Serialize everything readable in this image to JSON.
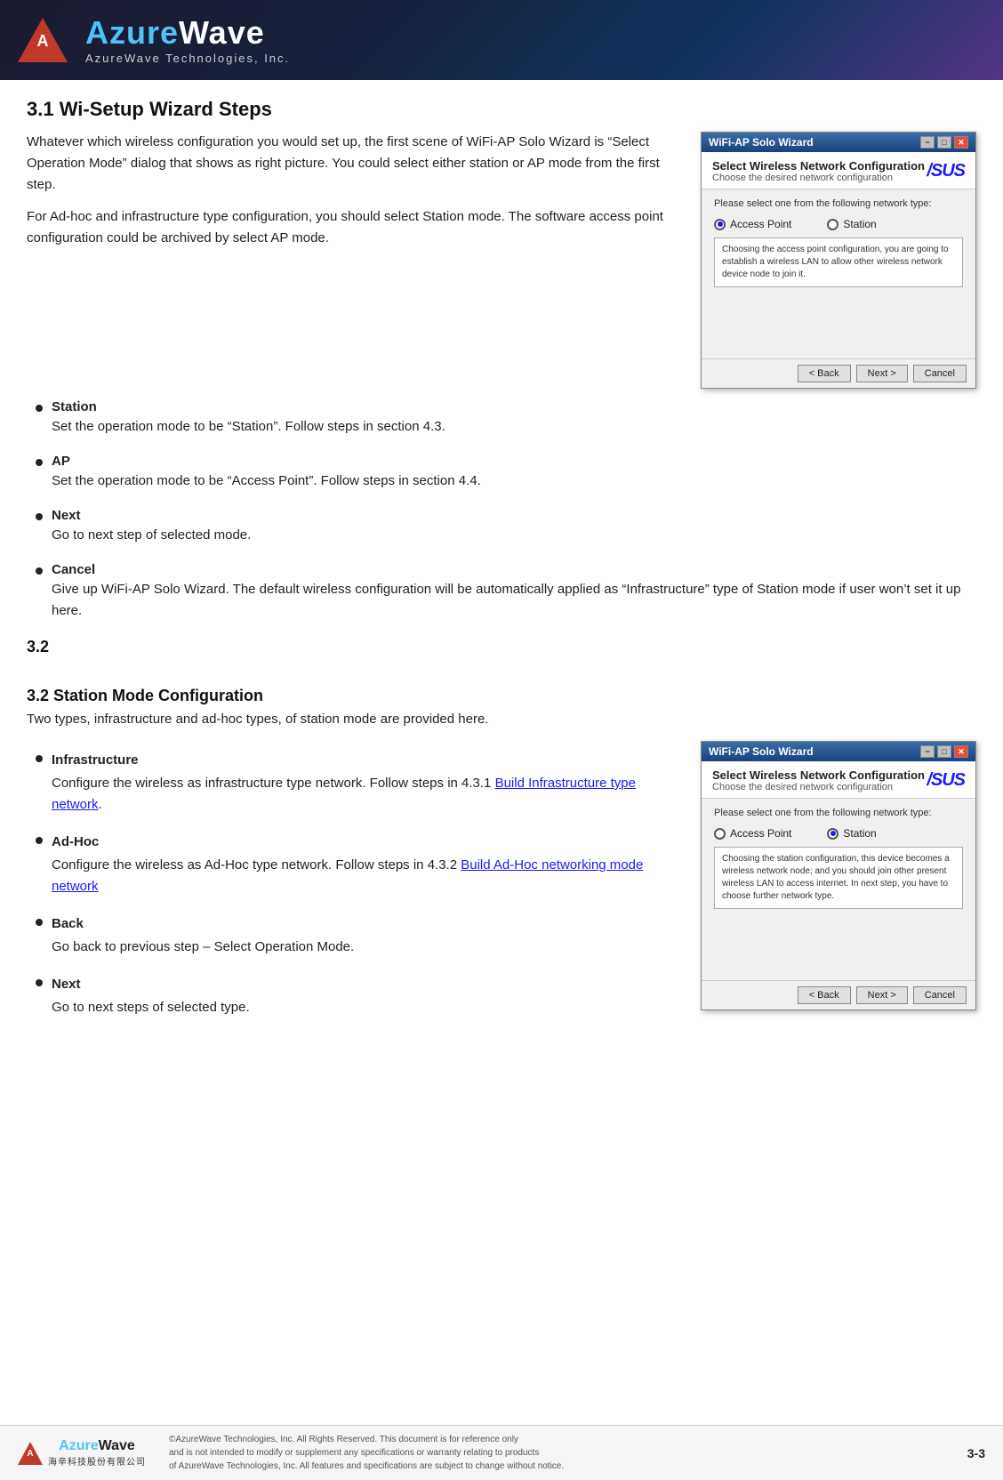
{
  "header": {
    "logo_brand_azure": "Azure",
    "logo_brand_wave": "Wave",
    "logo_sub": "AzureWave   Technologies,   Inc.",
    "triangle_letter": "A"
  },
  "section31": {
    "number": "3.1",
    "title": " Wi-Setup Wizard Steps",
    "intro": "Whatever which wireless configuration you would set up, the first scene of WiFi-AP Solo Wizard is “Select Operation Mode” dialog that shows as right picture. You could select either station or AP mode from the first step.",
    "para2": "For Ad-hoc and infrastructure type configuration, you should select Station mode. The software access point configuration could be archived by select AP mode.",
    "bullets": [
      {
        "title": "Station",
        "desc": "Set the operation mode to be “Station”. Follow steps in section 4.3."
      },
      {
        "title": "AP",
        "desc": "Set the operation mode to be “Access Point”. Follow steps in section 4.4."
      },
      {
        "title": "Next",
        "desc": "Go to next step of selected mode."
      },
      {
        "title": "Cancel",
        "desc": "Give up WiFi-AP Solo Wizard. The default wireless configuration will be automatically applied as “Infrastructure” type of Station mode if user won’t set it up here."
      }
    ]
  },
  "wizard1": {
    "title": "WiFi-AP Solo Wizard",
    "close_btn": "✕",
    "min_btn": "−",
    "max_btn": "□",
    "header_title": "Select Wireless Network Configuration",
    "header_sub": "Choose the desired network configuration",
    "asus_logo": "/SUS",
    "body_label": "Please select one from the following network type:",
    "radio_ap": "Access Point",
    "radio_station": "Station",
    "radio_ap_selected": true,
    "radio_station_selected": false,
    "desc_text": "Choosing the access point configuration, you are going to establish a wireless LAN to allow other wireless network device node to join it.",
    "btn_back": "< Back",
    "btn_next": "Next >",
    "btn_cancel": "Cancel"
  },
  "section32_num": {
    "label": "3.2"
  },
  "section32": {
    "number": "3.2",
    "title": " Station Mode Configuration",
    "intro": "Two types, infrastructure and ad-hoc types, of station mode are provided here.",
    "bullets": [
      {
        "title": "Infrastructure",
        "desc": "Configure the wireless as infrastructure type network. Follow steps in 4.3.1 ",
        "link_text": "Build Infrastructure type network",
        "link_after": "."
      },
      {
        "title": "Ad-Hoc",
        "desc": "Configure the wireless as Ad-Hoc type network. Follow steps in 4.3.2 ",
        "link_text": "Build Ad-Hoc networking mode network",
        "link_after": ""
      },
      {
        "title": "Back",
        "desc": "Go back to previous step – Select Operation Mode."
      },
      {
        "title": "Next",
        "desc": "Go to next steps of selected type."
      }
    ]
  },
  "wizard2": {
    "title": "WiFi-AP Solo Wizard",
    "header_title": "Select Wireless Network Configuration",
    "header_sub": "Choose the desired network configuration",
    "asus_logo": "/SUS",
    "body_label": "Please select one from the following network type:",
    "radio_ap": "Access Point",
    "radio_station": "Station",
    "radio_ap_selected": false,
    "radio_station_selected": true,
    "desc_text": "Choosing the station configuration, this device becomes a wireless network node; and you should join other present wireless LAN to access internet. In next step, you have to choose further network type.",
    "btn_back": "< Back",
    "btn_next": "Next >",
    "btn_cancel": "Cancel"
  },
  "footer": {
    "logo_azure": "Azure",
    "logo_wave": "Wave",
    "logo_sub": "海辛科技股份有限公司",
    "copyright_line1": "©AzureWave Technologies, Inc. All Rights Reserved. This document is for reference only",
    "copyright_line2": "and is not intended to modify or supplement any specifications or  warranty relating to products",
    "copyright_line3": "of AzureWave Technologies, Inc.  All features and specifications are subject to change without notice.",
    "page_number": "3-3"
  }
}
